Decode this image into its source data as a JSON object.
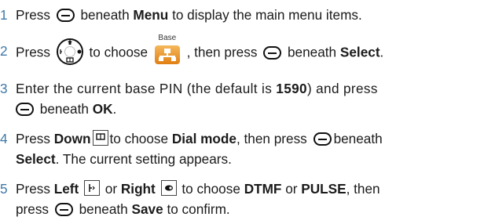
{
  "steps": [
    {
      "number": "1",
      "parts": {
        "a": "Press",
        "b": "beneath",
        "c": "Menu",
        "d": "to display the main menu items."
      }
    },
    {
      "number": "2",
      "parts": {
        "a": "Press",
        "b": "to choose",
        "c": ", then press",
        "d": "beneath",
        "e": "Select",
        "f": "."
      },
      "base_icon_label": "Base"
    },
    {
      "number": "3",
      "parts": {
        "a": "Enter the current base PIN (the default is",
        "b": "1590",
        "c": ") and press",
        "d": "beneath",
        "e": "OK",
        "f": "."
      }
    },
    {
      "number": "4",
      "parts": {
        "a": "Press",
        "b": "Down",
        "c": "to choose",
        "d": "Dial mode",
        "e": ", then press",
        "f": "beneath",
        "g": "Select",
        "h": ". The current setting appears."
      }
    },
    {
      "number": "5",
      "parts": {
        "a": "Press",
        "b": "Left",
        "c": "or",
        "d": "Right",
        "e": "to choose",
        "f": "DTMF",
        "g": "or",
        "h": "PULSE",
        "i": ", then",
        "j": "press",
        "k": "beneath",
        "l": "Save",
        "m": "to confirm."
      }
    }
  ],
  "icons": {
    "softkey": "softkey-icon",
    "nav": "navigation-key-icon",
    "base": "base-menu-icon",
    "down": "down-key-icon",
    "left": "left-key-icon",
    "right": "right-key-icon"
  },
  "colors": {
    "step_number": "#3f78a8",
    "text": "#1b1b1b",
    "base_icon": "#e8891d"
  }
}
